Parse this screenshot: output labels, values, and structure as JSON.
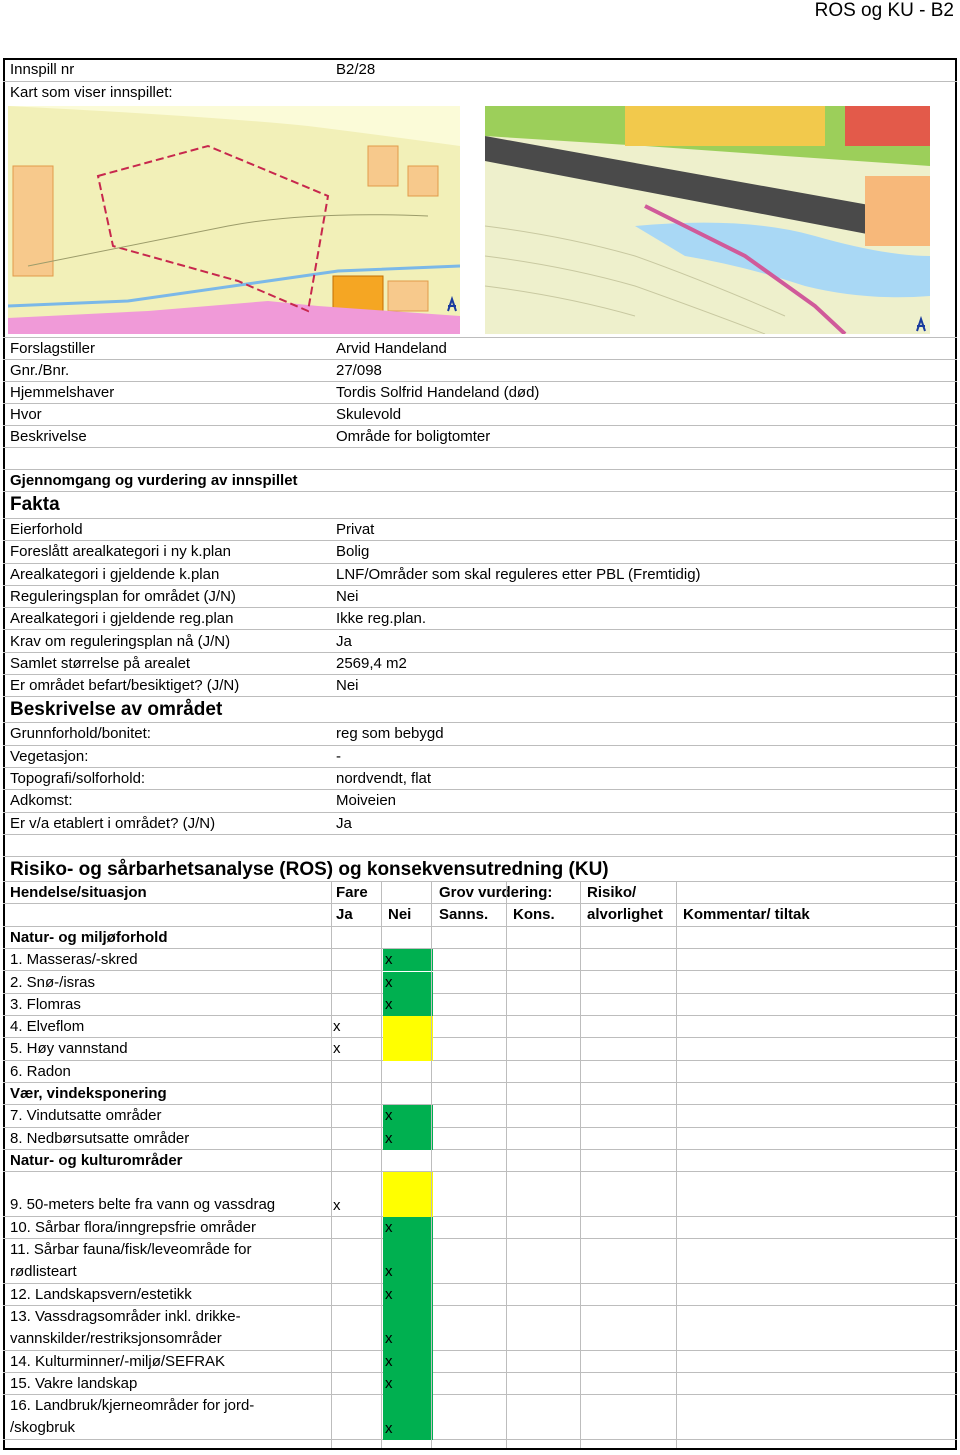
{
  "page_header": "ROS og KU - B2",
  "innspill": {
    "label": "Innspill nr",
    "value": "B2/28",
    "map_label": "Kart som viser innspillet:"
  },
  "info": [
    {
      "label": "Forslagstiller",
      "value": "Arvid Handeland"
    },
    {
      "label": "Gnr./Bnr.",
      "value": "27/098"
    },
    {
      "label": "Hjemmelshaver",
      "value": "Tordis Solfrid Handeland (død)"
    },
    {
      "label": "Hvor",
      "value": "Skulevold"
    },
    {
      "label": "Beskrivelse",
      "value": "Område for boligtomter"
    }
  ],
  "gjennomgang_title": "Gjennomgang og vurdering av innspillet",
  "fakta_title": "Fakta",
  "fakta": [
    {
      "label": "Eierforhold",
      "value": "Privat"
    },
    {
      "label": "Foreslått arealkategori i ny k.plan",
      "value": "Bolig"
    },
    {
      "label": "Arealkategori i gjeldende k.plan",
      "value": "LNF/Områder som skal reguleres etter PBL (Fremtidig)"
    },
    {
      "label": "Reguleringsplan for området (J/N)",
      "value": "Nei"
    },
    {
      "label": "Arealkategori i gjeldende reg.plan",
      "value": "Ikke reg.plan."
    },
    {
      "label": "Krav om reguleringsplan nå (J/N)",
      "value": "Ja"
    },
    {
      "label": "Samlet størrelse på arealet",
      "value": "2569,4 m2"
    },
    {
      "label": "Er området befart/besiktiget? (J/N)",
      "value": "Nei"
    }
  ],
  "beskrivelse_title": "Beskrivelse av området",
  "beskrivelse": [
    {
      "label": "Grunnforhold/bonitet:",
      "value": "reg som bebygd"
    },
    {
      "label": "Vegetasjon:",
      "value": "-"
    },
    {
      "label": "Topografi/solforhold:",
      "value": "nordvendt, flat"
    },
    {
      "label": "Adkomst:",
      "value": "Moiveien"
    },
    {
      "label": "Er v/a etablert i området? (J/N)",
      "value": "Ja"
    }
  ],
  "ros_title": "Risiko- og sårbarhetsanalyse (ROS) og konsekvensutredning (KU)",
  "table_header": {
    "hendelse": "Hendelse/situasjon",
    "fare": "Fare",
    "grov": "Grov vurdering:",
    "risiko": "Risiko/",
    "ja": "Ja",
    "nei": "Nei",
    "sanns": "Sanns.",
    "kons": "Kons.",
    "alvorlighet": "alvorlighet",
    "kommentar": "Kommentar/ tiltak"
  },
  "mark_symbol": "x",
  "colors": {
    "green": "#00b050",
    "yellow": "#ffff00"
  },
  "groups": {
    "natur_miljo": "Natur- og miljøforhold",
    "vaer": "Vær, vindeksponering",
    "natur_kultur": "Natur- og kulturområder"
  },
  "items": [
    {
      "label": "1. Masseras/-skred",
      "fare": "nei",
      "risk": "green"
    },
    {
      "label": "2. Snø-/isras",
      "fare": "nei",
      "risk": "green"
    },
    {
      "label": "3. Flomras",
      "fare": "nei",
      "risk": "green"
    },
    {
      "label": "4. Elveflom",
      "fare": "ja",
      "risk": "yellow"
    },
    {
      "label": "5. Høy vannstand",
      "fare": "ja",
      "risk": "yellow"
    },
    {
      "label": "6. Radon",
      "fare": "",
      "risk": ""
    },
    {
      "label": "7. Vindutsatte områder",
      "fare": "nei",
      "risk": "green"
    },
    {
      "label": "8. Nedbørsutsatte områder",
      "fare": "nei",
      "risk": "green"
    },
    {
      "label": "9. 50-meters belte fra vann og vassdrag",
      "fare": "ja",
      "risk": "yellow"
    },
    {
      "label": "10. Sårbar flora/inngrepsfrie områder",
      "fare": "nei",
      "risk": "green"
    },
    {
      "label_lines": [
        "11. Sårbar fauna/fisk/leveområde for",
        "rødlisteart"
      ],
      "fare": "nei",
      "risk": "green"
    },
    {
      "label": "12. Landskapsvern/estetikk",
      "fare": "nei",
      "risk": "green"
    },
    {
      "label_lines": [
        "13. Vassdragsområder inkl. drikke-",
        "vannskilder/restriksjonsområder"
      ],
      "fare": "nei",
      "risk": "green"
    },
    {
      "label": "14. Kulturminner/-miljø/SEFRAK",
      "fare": "nei",
      "risk": "green"
    },
    {
      "label": "15. Vakre landskap",
      "fare": "nei",
      "risk": "green"
    },
    {
      "label_lines": [
        "16. Landbruk/kjerneområder for jord-",
        "/skogbruk"
      ],
      "fare": "nei",
      "risk": "green"
    }
  ]
}
